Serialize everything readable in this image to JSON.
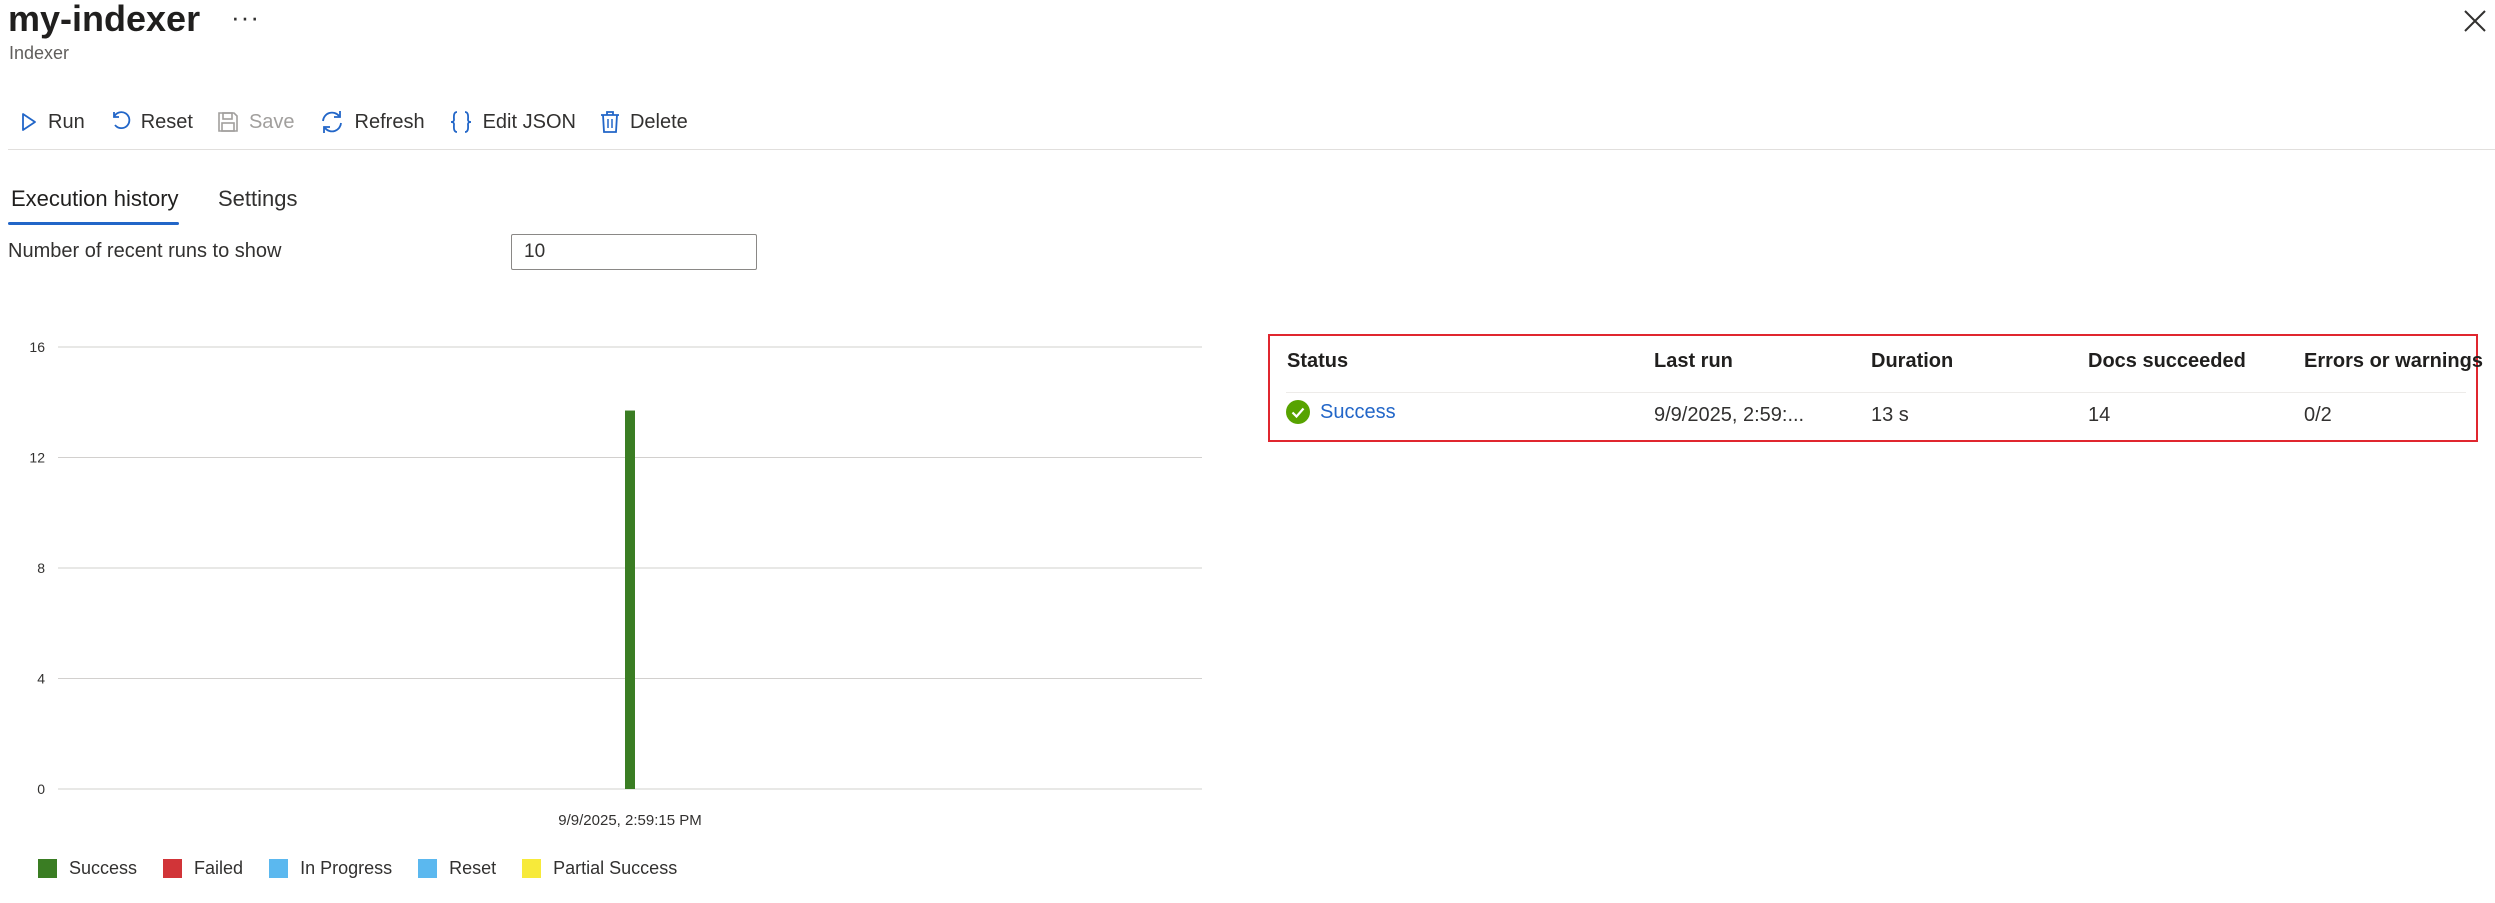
{
  "header": {
    "title": "my-indexer",
    "subtitle": "Indexer",
    "more_label": "···"
  },
  "toolbar": {
    "run": "Run",
    "reset": "Reset",
    "save": "Save",
    "refresh": "Refresh",
    "edit_json": "Edit JSON",
    "delete": "Delete"
  },
  "tabs": {
    "execution_history": "Execution history",
    "settings": "Settings"
  },
  "runs_filter": {
    "label": "Number of recent runs to show",
    "value": "10"
  },
  "chart_data": {
    "type": "bar",
    "categories": [
      "9/9/2025, 2:59:15 PM"
    ],
    "series": [
      {
        "name": "Success",
        "values": [
          13.7
        ],
        "color": "#3a7d23"
      }
    ],
    "yticks": [
      0,
      4,
      8,
      12,
      16
    ],
    "ylim": [
      0,
      16
    ],
    "grid": true
  },
  "legend": [
    {
      "label": "Success",
      "color": "#3a7d23"
    },
    {
      "label": "Failed",
      "color": "#d13438"
    },
    {
      "label": "In Progress",
      "color": "#5bb8ef"
    },
    {
      "label": "Reset",
      "color": "#5bb8ef"
    },
    {
      "label": "Partial Success",
      "color": "#f7ea3a"
    }
  ],
  "table": {
    "headers": [
      "Status",
      "Last run",
      "Duration",
      "Docs succeeded",
      "Errors or warnings"
    ],
    "rows": [
      {
        "status": "Success",
        "last_run": "9/9/2025, 2:59:...",
        "duration": "13 s",
        "docs": "14",
        "errors": "0/2"
      }
    ]
  },
  "colors": {
    "accent": "#2266c8",
    "success": "#3a7d23",
    "highlight": "#e0262f"
  },
  "icons": {
    "run": "play-icon",
    "reset": "undo-icon",
    "save": "save-icon",
    "refresh": "refresh-icon",
    "edit_json": "braces-icon",
    "delete": "trash-icon",
    "close": "close-icon",
    "status": "check-circle-icon"
  }
}
